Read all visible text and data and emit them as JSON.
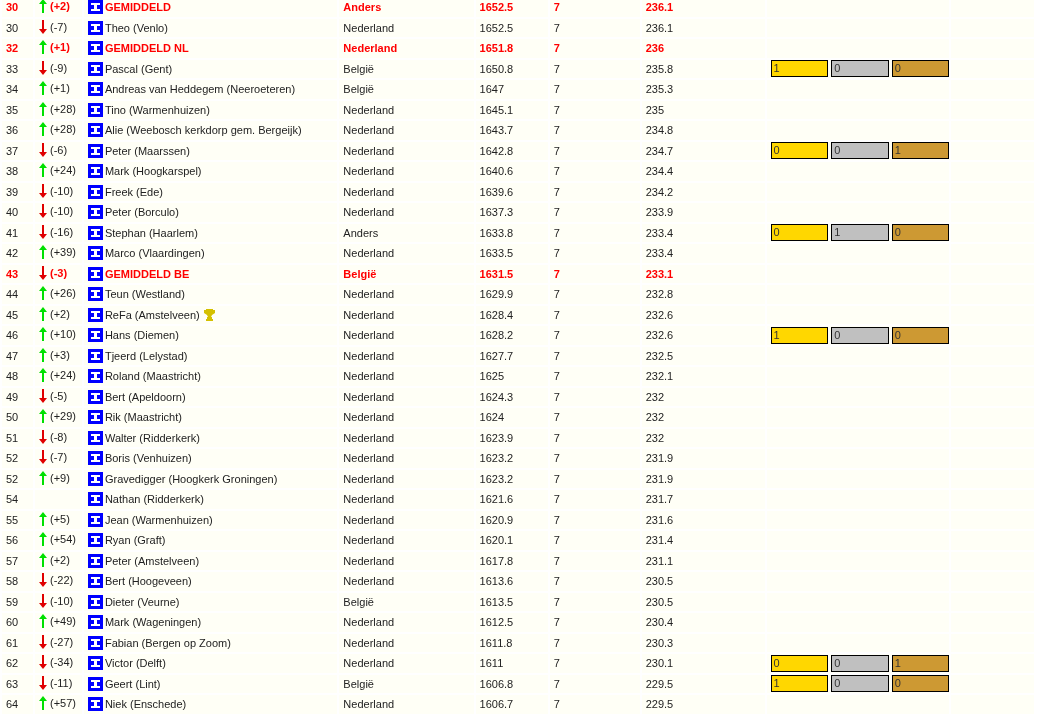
{
  "ranking": {
    "rows": [
      {
        "rank": "30",
        "up": true,
        "down": false,
        "change": "(+2)",
        "name": "GEMIDDELD",
        "country": "Anders",
        "score": "1652.5",
        "games": "7",
        "average": "236.1",
        "kind": "average"
      },
      {
        "rank": "30",
        "up": false,
        "down": true,
        "change": "(-7)",
        "name": "Theo (Venlo)",
        "country": "Nederland",
        "score": "1652.5",
        "games": "7",
        "average": "236.1",
        "kind": "player"
      },
      {
        "rank": "32",
        "up": true,
        "down": false,
        "change": "(+1)",
        "name": "GEMIDDELD NL",
        "country": "Nederland",
        "score": "1651.8",
        "games": "7",
        "average": "236",
        "kind": "average"
      },
      {
        "rank": "33",
        "up": false,
        "down": true,
        "change": "(-9)",
        "name": "Pascal (Gent)",
        "country": "België",
        "score": "1650.8",
        "games": "7",
        "average": "235.8",
        "kind": "player",
        "medals": {
          "gold": "1",
          "silver": "0",
          "bronze": "0"
        }
      },
      {
        "rank": "34",
        "up": true,
        "down": false,
        "change": "(+1)",
        "name": "Andreas van Heddegem (Neeroeteren)",
        "country": "België",
        "score": "1647",
        "games": "7",
        "average": "235.3",
        "kind": "player"
      },
      {
        "rank": "35",
        "up": true,
        "down": false,
        "change": "(+28)",
        "name": "Tino (Warmenhuizen)",
        "country": "Nederland",
        "score": "1645.1",
        "games": "7",
        "average": "235",
        "kind": "player"
      },
      {
        "rank": "36",
        "up": true,
        "down": false,
        "change": "(+28)",
        "name": "Alie (Weebosch kerkdorp gem. Bergeijk)",
        "country": "Nederland",
        "score": "1643.7",
        "games": "7",
        "average": "234.8",
        "kind": "player"
      },
      {
        "rank": "37",
        "up": false,
        "down": true,
        "change": "(-6)",
        "name": "Peter (Maarssen)",
        "country": "Nederland",
        "score": "1642.8",
        "games": "7",
        "average": "234.7",
        "kind": "player",
        "medals": {
          "gold": "0",
          "silver": "0",
          "bronze": "1"
        }
      },
      {
        "rank": "38",
        "up": true,
        "down": false,
        "change": "(+24)",
        "name": "Mark (Hoogkarspel)",
        "country": "Nederland",
        "score": "1640.6",
        "games": "7",
        "average": "234.4",
        "kind": "player"
      },
      {
        "rank": "39",
        "up": false,
        "down": true,
        "change": "(-10)",
        "name": "Freek (Ede)",
        "country": "Nederland",
        "score": "1639.6",
        "games": "7",
        "average": "234.2",
        "kind": "player"
      },
      {
        "rank": "40",
        "up": false,
        "down": true,
        "change": "(-10)",
        "name": "Peter (Borculo)",
        "country": "Nederland",
        "score": "1637.3",
        "games": "7",
        "average": "233.9",
        "kind": "player"
      },
      {
        "rank": "41",
        "up": false,
        "down": true,
        "change": "(-16)",
        "name": "Stephan (Haarlem)",
        "country": "Anders",
        "score": "1633.8",
        "games": "7",
        "average": "233.4",
        "kind": "player",
        "medals": {
          "gold": "0",
          "silver": "1",
          "bronze": "0"
        }
      },
      {
        "rank": "42",
        "up": true,
        "down": false,
        "change": "(+39)",
        "name": "Marco (Vlaardingen)",
        "country": "Nederland",
        "score": "1633.5",
        "games": "7",
        "average": "233.4",
        "kind": "player"
      },
      {
        "rank": "43",
        "up": false,
        "down": true,
        "change": "(-3)",
        "name": "GEMIDDELD BE",
        "country": "België",
        "score": "1631.5",
        "games": "7",
        "average": "233.1",
        "kind": "average"
      },
      {
        "rank": "44",
        "up": true,
        "down": false,
        "change": "(+26)",
        "name": "Teun (Westland)",
        "country": "Nederland",
        "score": "1629.9",
        "games": "7",
        "average": "232.8",
        "kind": "player"
      },
      {
        "rank": "45",
        "up": true,
        "down": false,
        "change": "(+2)",
        "name": "ReFa (Amstelveen)",
        "country": "Nederland",
        "score": "1628.4",
        "games": "7",
        "average": "232.6",
        "kind": "player",
        "trophy": true
      },
      {
        "rank": "46",
        "up": true,
        "down": false,
        "change": "(+10)",
        "name": "Hans (Diemen)",
        "country": "Nederland",
        "score": "1628.2",
        "games": "7",
        "average": "232.6",
        "kind": "player",
        "medals": {
          "gold": "1",
          "silver": "0",
          "bronze": "0"
        }
      },
      {
        "rank": "47",
        "up": true,
        "down": false,
        "change": "(+3)",
        "name": "Tjeerd (Lelystad)",
        "country": "Nederland",
        "score": "1627.7",
        "games": "7",
        "average": "232.5",
        "kind": "player"
      },
      {
        "rank": "48",
        "up": true,
        "down": false,
        "change": "(+24)",
        "name": "Roland (Maastricht)",
        "country": "Nederland",
        "score": "1625",
        "games": "7",
        "average": "232.1",
        "kind": "player"
      },
      {
        "rank": "49",
        "up": false,
        "down": true,
        "change": "(-5)",
        "name": "Bert (Apeldoorn)",
        "country": "Nederland",
        "score": "1624.3",
        "games": "7",
        "average": "232",
        "kind": "player"
      },
      {
        "rank": "50",
        "up": true,
        "down": false,
        "change": "(+29)",
        "name": "Rik (Maastricht)",
        "country": "Nederland",
        "score": "1624",
        "games": "7",
        "average": "232",
        "kind": "player"
      },
      {
        "rank": "51",
        "up": false,
        "down": true,
        "change": "(-8)",
        "name": "Walter (Ridderkerk)",
        "country": "Nederland",
        "score": "1623.9",
        "games": "7",
        "average": "232",
        "kind": "player"
      },
      {
        "rank": "52",
        "up": false,
        "down": true,
        "change": "(-7)",
        "name": "Boris (Venhuizen)",
        "country": "Nederland",
        "score": "1623.2",
        "games": "7",
        "average": "231.9",
        "kind": "player"
      },
      {
        "rank": "52",
        "up": true,
        "down": false,
        "change": "(+9)",
        "name": "Gravedigger (Hoogkerk Groningen)",
        "country": "Nederland",
        "score": "1623.2",
        "games": "7",
        "average": "231.9",
        "kind": "player"
      },
      {
        "rank": "54",
        "up": false,
        "down": false,
        "name": "Nathan (Ridderkerk)",
        "country": "Nederland",
        "score": "1621.6",
        "games": "7",
        "average": "231.7",
        "kind": "player"
      },
      {
        "rank": "55",
        "up": true,
        "down": false,
        "change": "(+5)",
        "name": "Jean (Warmenhuizen)",
        "country": "Nederland",
        "score": "1620.9",
        "games": "7",
        "average": "231.6",
        "kind": "player"
      },
      {
        "rank": "56",
        "up": true,
        "down": false,
        "change": "(+54)",
        "name": "Ryan (Graft)",
        "country": "Nederland",
        "score": "1620.1",
        "games": "7",
        "average": "231.4",
        "kind": "player"
      },
      {
        "rank": "57",
        "up": true,
        "down": false,
        "change": "(+2)",
        "name": "Peter (Amstelveen)",
        "country": "Nederland",
        "score": "1617.8",
        "games": "7",
        "average": "231.1",
        "kind": "player"
      },
      {
        "rank": "58",
        "up": false,
        "down": true,
        "change": "(-22)",
        "name": "Bert (Hoogeveen)",
        "country": "Nederland",
        "score": "1613.6",
        "games": "7",
        "average": "230.5",
        "kind": "player"
      },
      {
        "rank": "59",
        "up": false,
        "down": true,
        "change": "(-10)",
        "name": "Dieter (Veurne)",
        "country": "België",
        "score": "1613.5",
        "games": "7",
        "average": "230.5",
        "kind": "player"
      },
      {
        "rank": "60",
        "up": true,
        "down": false,
        "change": "(+49)",
        "name": "Mark (Wageningen)",
        "country": "Nederland",
        "score": "1612.5",
        "games": "7",
        "average": "230.4",
        "kind": "player"
      },
      {
        "rank": "61",
        "up": false,
        "down": true,
        "change": "(-27)",
        "name": "Fabian (Bergen op Zoom)",
        "country": "Nederland",
        "score": "1611.8",
        "games": "7",
        "average": "230.3",
        "kind": "player"
      },
      {
        "rank": "62",
        "up": false,
        "down": true,
        "change": "(-34)",
        "name": "Victor (Delft)",
        "country": "Nederland",
        "score": "1611",
        "games": "7",
        "average": "230.1",
        "kind": "player",
        "medals": {
          "gold": "0",
          "silver": "0",
          "bronze": "1"
        }
      },
      {
        "rank": "63",
        "up": false,
        "down": true,
        "change": "(-11)",
        "name": "Geert (Lint)",
        "country": "België",
        "score": "1606.8",
        "games": "7",
        "average": "229.5",
        "kind": "player",
        "medals": {
          "gold": "1",
          "silver": "0",
          "bronze": "0"
        }
      },
      {
        "rank": "64",
        "up": true,
        "down": false,
        "change": "(+57)",
        "name": "Niek (Enschede)",
        "country": "Nederland",
        "score": "1606.7",
        "games": "7",
        "average": "229.5",
        "kind": "player"
      }
    ]
  }
}
